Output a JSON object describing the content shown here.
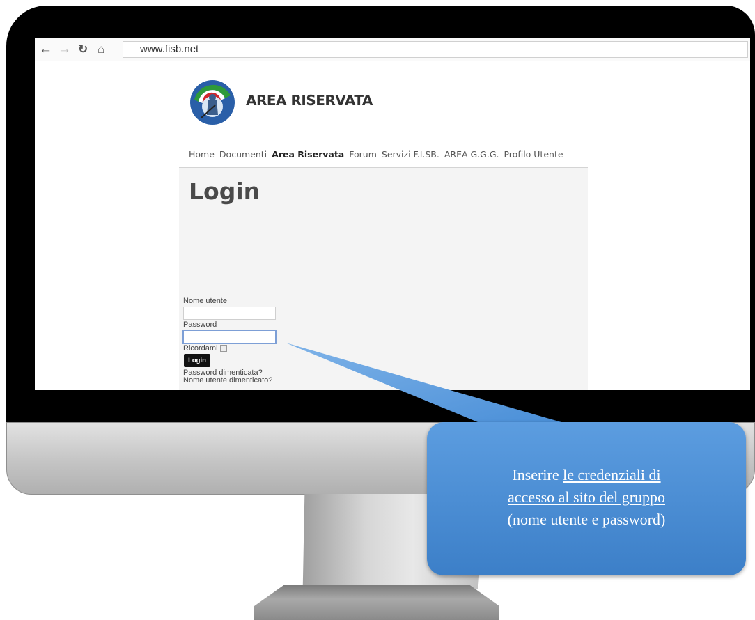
{
  "browser": {
    "url": "www.fisb.net",
    "icons": [
      "back-arrow-icon",
      "forward-arrow-icon",
      "reload-icon",
      "home-icon",
      "page-icon"
    ]
  },
  "site": {
    "brand": "AREA RISERVATA",
    "menu": [
      "Home",
      "Documenti",
      "Area Riservata",
      "Forum",
      "Servizi F.I.SB.",
      "AREA G.G.G.",
      "Profilo Utente"
    ],
    "active_menu": "Area Riservata"
  },
  "login": {
    "title": "Login",
    "username_label": "Nome utente",
    "username_value": "",
    "password_label": "Password",
    "password_value": "",
    "remember_label": "Ricordami",
    "remember_checked": false,
    "button_label": "Login",
    "forgot_password": "Password dimenticata?",
    "forgot_username": "Nome utente dimenticato?"
  },
  "callout": {
    "line1_prefix": "Inserire ",
    "line1_underlined": "le ",
    "line1_bold": "credenziali di",
    "line2": "accesso al sito del gruppo",
    "line3": "(nome utente e password)",
    "color": "#4a8fd8"
  }
}
